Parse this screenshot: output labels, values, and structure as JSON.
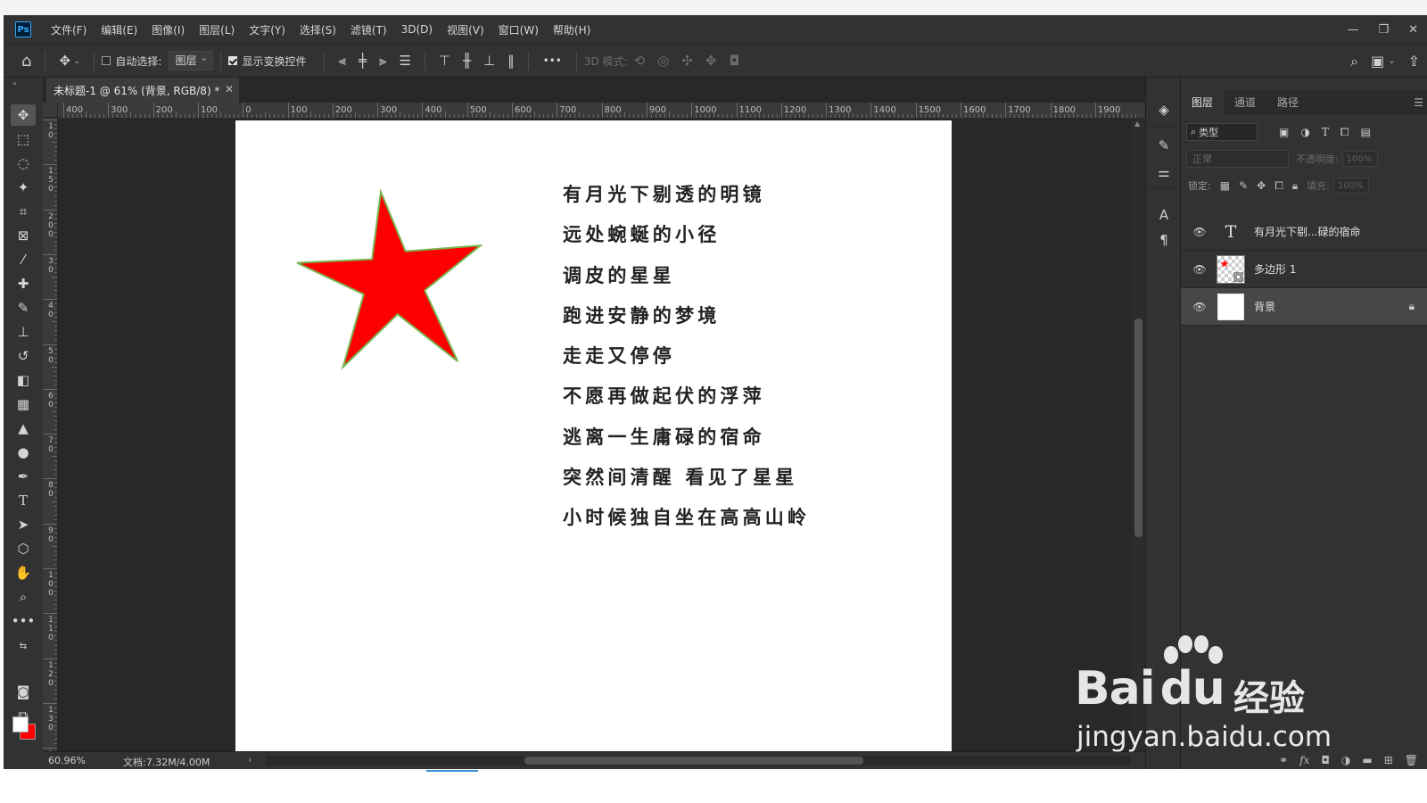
{
  "app": {
    "logo": "Ps"
  },
  "menu": [
    "文件(F)",
    "编辑(E)",
    "图像(I)",
    "图层(L)",
    "文字(Y)",
    "选择(S)",
    "滤镜(T)",
    "3D(D)",
    "视图(V)",
    "窗口(W)",
    "帮助(H)"
  ],
  "options": {
    "auto_select_label": "自动选择:",
    "auto_select_checked": false,
    "auto_select_target": "图层",
    "show_transform_label": "显示变换控件",
    "show_transform_checked": true,
    "more": "•••",
    "mode_3d_label": "3D 模式:"
  },
  "document": {
    "tab_title": "未标题-1 @ 61% (背景, RGB/8) *",
    "star_fill": "#ff0000",
    "star_stroke": "#78b450",
    "poem_lines": [
      "有月光下剔透的明镜",
      "远处蜿蜒的小径",
      "调皮的星星",
      "跑进安静的梦境",
      "走走又停停",
      "不愿再做起伏的浮萍",
      "逃离一生庸碌的宿命",
      "突然间清醒 看见了星星",
      "小时候独自坐在高高山岭"
    ]
  },
  "ruler": {
    "h_labels": [
      "400",
      "300",
      "200",
      "100",
      "0",
      "100",
      "200",
      "300",
      "400",
      "500",
      "600",
      "700",
      "800",
      "900",
      "1000",
      "1100",
      "1200",
      "1300",
      "1400",
      "1500",
      "1600",
      "1700",
      "1800",
      "1900"
    ],
    "v_labels": [
      "1 0",
      "1 5 0",
      "2 0 0",
      "3 0",
      "4 0",
      "5 0",
      "6 0",
      "7 0",
      "8 0",
      "9 0",
      "1 0 0",
      "1 1 0",
      "1 2 0",
      "1 3 0",
      "1 4 0"
    ]
  },
  "status": {
    "zoom": "60.96%",
    "doc_info": "文档:7.32M/4.00M",
    "arrow": "›"
  },
  "layers_panel": {
    "tabs": [
      "图层",
      "通道",
      "路径"
    ],
    "filter_label": "类型",
    "blend_mode": "正常",
    "opacity_label": "不透明度:",
    "opacity_value": "100%",
    "lock_label": "锁定:",
    "fill_label": "填充:",
    "fill_value": "100%",
    "layers": [
      {
        "name": "有月光下剔...碌的宿命",
        "kind": "text",
        "thumb_glyph": "T"
      },
      {
        "name": "多边形 1",
        "kind": "shape"
      },
      {
        "name": "背景",
        "kind": "background",
        "locked": true
      }
    ]
  },
  "colors": {
    "foreground": "#ffffff",
    "background": "#ff0000",
    "accent": "#31a8ff"
  },
  "watermark": {
    "brand_latin_1": "Bai",
    "brand_latin_2": "du",
    "brand_cn": "经验",
    "url": "jingyan.baidu.com"
  }
}
